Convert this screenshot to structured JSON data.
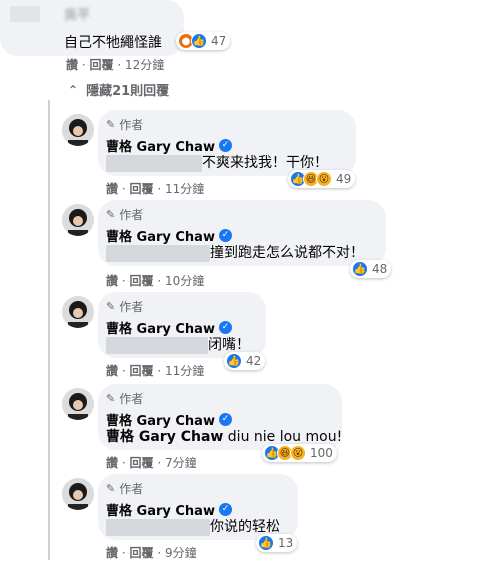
{
  "top_comment": {
    "name": "吳平",
    "text": "自己不牠繩怪誰",
    "reaction_count": "47",
    "like": "讚",
    "reply": "回覆",
    "time": "12分鐘"
  },
  "hide_replies": "隱藏21則回覆",
  "author_badge": "作者",
  "author_name": "曹格 Gary Chaw",
  "actions": {
    "like": "讚",
    "reply": "回覆",
    "sep": "·"
  },
  "replies": [
    {
      "text": "不爽来找我！干你！",
      "time": "11分鐘",
      "count": "49"
    },
    {
      "text": "撞到跑走怎么说都不对！",
      "time": "10分鐘",
      "count": "48"
    },
    {
      "text": "闭嘴！",
      "time": "11分鐘",
      "count": "42"
    },
    {
      "mention": "曹格 Gary Chaw",
      "text": "diu nie lou mou!",
      "time": "7分鐘",
      "count": "100"
    },
    {
      "text": "你说的轻松",
      "time": "9分鐘",
      "count": "13"
    }
  ],
  "colors": {
    "like": "#1877f2",
    "bubble": "#f0f2f5",
    "meta": "#65676b",
    "text": "#050505"
  },
  "icons": [
    "chevron-up-icon",
    "pencil-icon",
    "verified-badge-icon",
    "like-reaction-icon",
    "haha-reaction-icon",
    "wow-reaction-icon",
    "angry-reaction-icon"
  ]
}
